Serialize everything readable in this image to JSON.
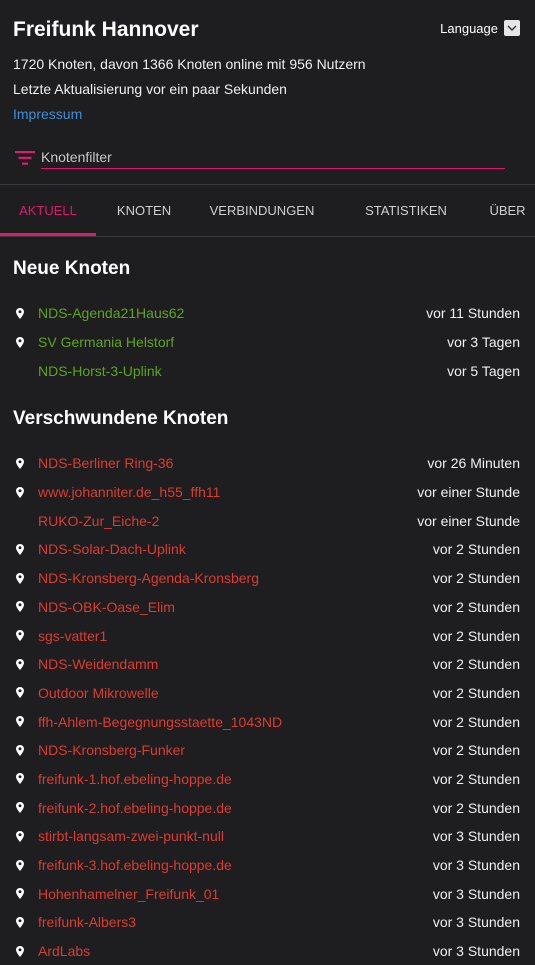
{
  "header": {
    "title": "Freifunk Hannover",
    "language_label": "Language",
    "stats_line": "1720 Knoten, davon 1366 Knoten online mit 956 Nutzern",
    "update_line": "Letzte Aktualisierung vor ein paar Sekunden",
    "imprint_link": "Impressum"
  },
  "filter": {
    "placeholder": "Knotenfilter"
  },
  "tabs": [
    {
      "label": "AKTUELL",
      "active": true
    },
    {
      "label": "KNOTEN",
      "active": false
    },
    {
      "label": "VERBINDUNGEN",
      "active": false
    },
    {
      "label": "STATISTIKEN",
      "active": false
    },
    {
      "label": "ÜBER",
      "active": false
    }
  ],
  "new_nodes": {
    "title": "Neue Knoten",
    "items": [
      {
        "name": "NDS-Agenda21Haus62",
        "time": "vor 11 Stunden",
        "has_pin": true
      },
      {
        "name": "SV Germania Helstorf",
        "time": "vor 3 Tagen",
        "has_pin": true
      },
      {
        "name": "NDS-Horst-3-Uplink",
        "time": "vor 5 Tagen",
        "has_pin": false
      }
    ]
  },
  "gone_nodes": {
    "title": "Verschwundene Knoten",
    "items": [
      {
        "name": "NDS-Berliner Ring-36",
        "time": "vor 26 Minuten",
        "has_pin": true
      },
      {
        "name": "www.johanniter.de_h55_ffh11",
        "time": "vor einer Stunde",
        "has_pin": true
      },
      {
        "name": "RUKO-Zur_Eiche-2",
        "time": "vor einer Stunde",
        "has_pin": false
      },
      {
        "name": "NDS-Solar-Dach-Uplink",
        "time": "vor 2 Stunden",
        "has_pin": true
      },
      {
        "name": "NDS-Kronsberg-Agenda-Kronsberg",
        "time": "vor 2 Stunden",
        "has_pin": true
      },
      {
        "name": "NDS-OBK-Oase_Elim",
        "time": "vor 2 Stunden",
        "has_pin": true
      },
      {
        "name": "sgs-vatter1",
        "time": "vor 2 Stunden",
        "has_pin": true
      },
      {
        "name": "NDS-Weidendamm",
        "time": "vor 2 Stunden",
        "has_pin": true
      },
      {
        "name": "Outdoor Mikrowelle",
        "time": "vor 2 Stunden",
        "has_pin": true
      },
      {
        "name": "ffh-Ahlem-Begegnungsstaette_1043ND",
        "time": "vor 2 Stunden",
        "has_pin": true
      },
      {
        "name": "NDS-Kronsberg-Funker",
        "time": "vor 2 Stunden",
        "has_pin": true
      },
      {
        "name": "freifunk-1.hof.ebeling-hoppe.de",
        "time": "vor 2 Stunden",
        "has_pin": true
      },
      {
        "name": "freifunk-2.hof.ebeling-hoppe.de",
        "time": "vor 2 Stunden",
        "has_pin": true
      },
      {
        "name": "stirbt-langsam-zwei-punkt-null",
        "time": "vor 3 Stunden",
        "has_pin": true
      },
      {
        "name": "freifunk-3.hof.ebeling-hoppe.de",
        "time": "vor 3 Stunden",
        "has_pin": true
      },
      {
        "name": "Hohenhamelner_Freifunk_01",
        "time": "vor 3 Stunden",
        "has_pin": true
      },
      {
        "name": "freifunk-Albers3",
        "time": "vor 3 Stunden",
        "has_pin": true
      },
      {
        "name": "ArdLabs",
        "time": "vor 3 Stunden",
        "has_pin": true
      }
    ]
  },
  "colors": {
    "accent": "#dc1a6e",
    "new_node": "#5ea51e",
    "gone_node": "#dc3c32",
    "link": "#3d8fd6",
    "background": "#1e1d1f"
  }
}
